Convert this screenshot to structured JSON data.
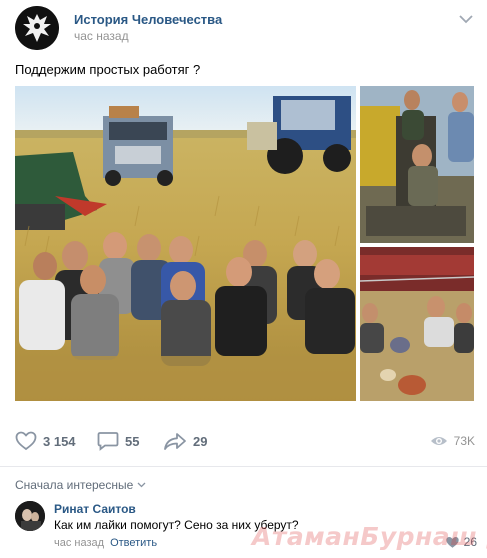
{
  "post": {
    "author": "История Человечества",
    "time": "час назад",
    "text": "Поддержим простых работяг ?"
  },
  "icons": {
    "author_avatar": "eagle-emblem-icon",
    "menu": "chevron-down-icon",
    "like": "heart-icon",
    "comment": "speech-bubble-icon",
    "share": "share-arrow-icon",
    "views": "eye-icon",
    "comment_like": "heart-icon"
  },
  "photos": [
    {
      "description_icon": "photo-workers-in-field"
    },
    {
      "description_icon": "photo-workers-on-tractor"
    },
    {
      "description_icon": "photo-workers-resting"
    }
  ],
  "actions": {
    "likes": "3 154",
    "comments": "55",
    "shares": "29",
    "views": "73K"
  },
  "comments_section": {
    "sort_label": "Сначала интересные",
    "items": [
      {
        "author": "Ринат Саитов",
        "text": "Как им лайки помогут? Сено за них уберут?",
        "time": "час назад",
        "reply_label": "Ответить",
        "likes": "26"
      }
    ]
  },
  "watermark": "АтаманБурнаш для ЯП",
  "colors": {
    "link": "#2a5885",
    "meta": "#939393",
    "action": "#626d7a"
  }
}
